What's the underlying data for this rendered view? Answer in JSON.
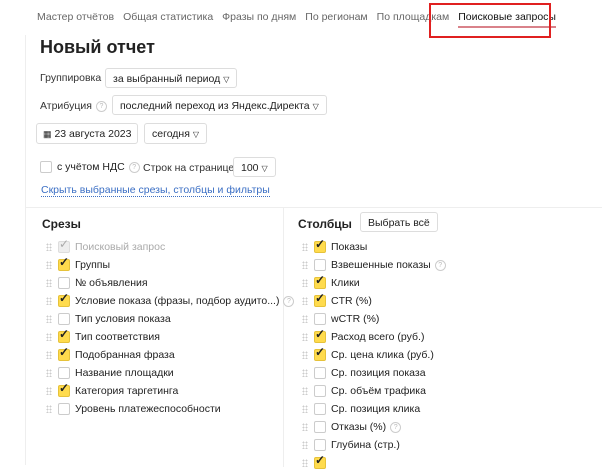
{
  "tabs": [
    "Мастер отчётов",
    "Общая статистика",
    "Фразы по дням",
    "По регионам",
    "По площадкам",
    "Поисковые запросы"
  ],
  "active_tab": 5,
  "title": "Новый отчет",
  "grouping": {
    "label": "Группировка",
    "value": "за выбранный период"
  },
  "attribution": {
    "label": "Атрибуция",
    "value": "последний переход из Яндекс.Директа"
  },
  "date": {
    "value": "23 августа 2023",
    "period": "сегодня"
  },
  "vat": {
    "label": "с учётом НДС",
    "checked": false
  },
  "rows_per_page": {
    "label": "Строк на странице",
    "value": "100"
  },
  "hide_link": "Скрыть выбранные срезы, столбцы и фильтры",
  "slices": {
    "title": "Срезы",
    "items": [
      {
        "label": "Поисковый запрос",
        "checked": true,
        "disabled": true
      },
      {
        "label": "Группы",
        "checked": true
      },
      {
        "label": "№ объявления",
        "checked": false
      },
      {
        "label": "Условие показа (фразы, подбор аудито...)",
        "checked": true,
        "help": true
      },
      {
        "label": "Тип условия показа",
        "checked": false
      },
      {
        "label": "Тип соответствия",
        "checked": true
      },
      {
        "label": "Подобранная фраза",
        "checked": true
      },
      {
        "label": "Название площадки",
        "checked": false
      },
      {
        "label": "Категория таргетинга",
        "checked": true
      },
      {
        "label": "Уровень платежеспособности",
        "checked": false
      }
    ]
  },
  "columns": {
    "title": "Столбцы",
    "select_all": "Выбрать всё",
    "items": [
      {
        "label": "Показы",
        "checked": true
      },
      {
        "label": "Взвешенные показы",
        "checked": false,
        "help": true
      },
      {
        "label": "Клики",
        "checked": true
      },
      {
        "label": "CTR (%)",
        "checked": true
      },
      {
        "label": "wCTR (%)",
        "checked": false
      },
      {
        "label": "Расход всего (руб.)",
        "checked": true
      },
      {
        "label": "Ср. цена клика (руб.)",
        "checked": true
      },
      {
        "label": "Ср. позиция показа",
        "checked": false
      },
      {
        "label": "Ср. объём трафика",
        "checked": false
      },
      {
        "label": "Ср. позиция клика",
        "checked": false
      },
      {
        "label": "Отказы (%)",
        "checked": false,
        "help": true
      },
      {
        "label": "Глубина (стр.)",
        "checked": false
      },
      {
        "label": "",
        "checked": true
      }
    ]
  }
}
